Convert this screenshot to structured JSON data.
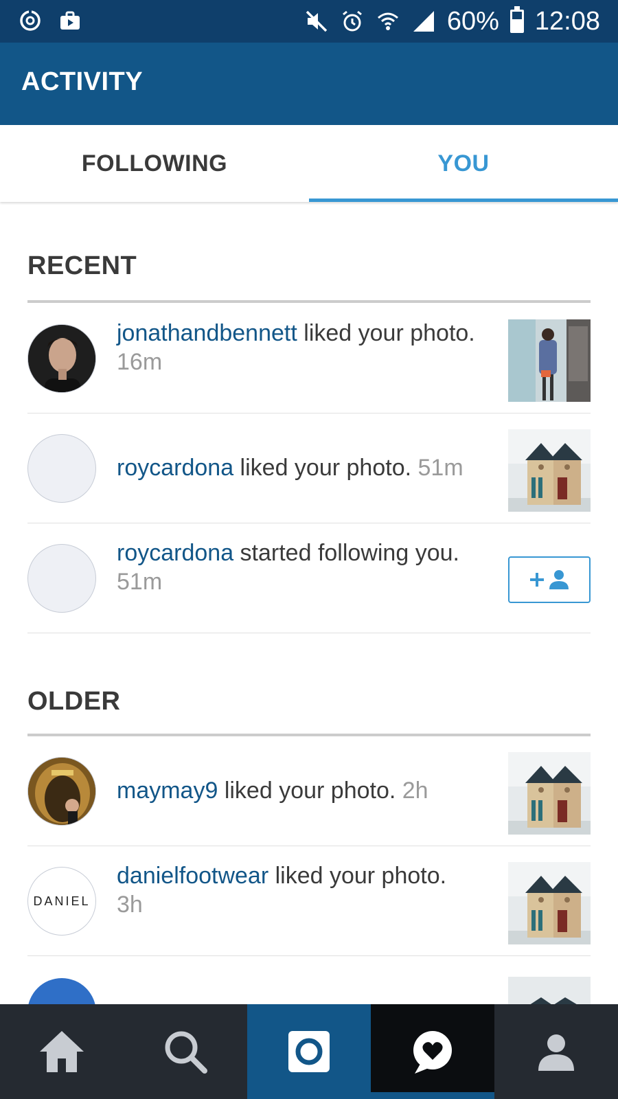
{
  "status_bar": {
    "battery": "60%",
    "battery_level": 0.6,
    "time": "12:08",
    "icons_left": [
      "sync-icon",
      "briefcase-icon"
    ],
    "icons_right": [
      "mute-icon",
      "alarm-icon",
      "wifi-icon",
      "signal-icon"
    ]
  },
  "app_bar": {
    "title": "ACTIVITY"
  },
  "tabs": [
    {
      "label": "FOLLOWING",
      "active": false
    },
    {
      "label": "YOU",
      "active": true
    }
  ],
  "sections": {
    "recent": {
      "title": "RECENT"
    },
    "older": {
      "title": "OLDER"
    }
  },
  "recent_items": [
    {
      "username": "jonathandbennett",
      "action": " liked your photo.",
      "time": "16m",
      "avatar": "photo-avatar",
      "trailing": "photo-thumbnail"
    },
    {
      "username": "roycardona",
      "action": " liked your photo.",
      "time": "51m",
      "avatar": "blank-avatar",
      "trailing": "photo-thumbnail"
    },
    {
      "username": "roycardona",
      "action": " started following you.",
      "time": "51m",
      "avatar": "blank-avatar",
      "trailing": "follow-button"
    }
  ],
  "older_items": [
    {
      "username": "maymay9",
      "action": " liked your photo.",
      "time": "2h",
      "avatar": "photo-avatar",
      "trailing": "photo-thumbnail"
    },
    {
      "username": "danielfootwear",
      "action": " liked your photo.",
      "time": "3h",
      "avatar": "DANIEL",
      "trailing": "photo-thumbnail"
    }
  ],
  "bottom_nav": [
    {
      "name": "home-icon"
    },
    {
      "name": "search-icon"
    },
    {
      "name": "camera-icon"
    },
    {
      "name": "activity-heart-icon",
      "active": true
    },
    {
      "name": "profile-icon"
    }
  ],
  "colors": {
    "status_bar": "#0f3f6b",
    "app_bar": "#125688",
    "accent": "#3897d3",
    "username": "#125688",
    "nav_bg": "#252a31"
  }
}
